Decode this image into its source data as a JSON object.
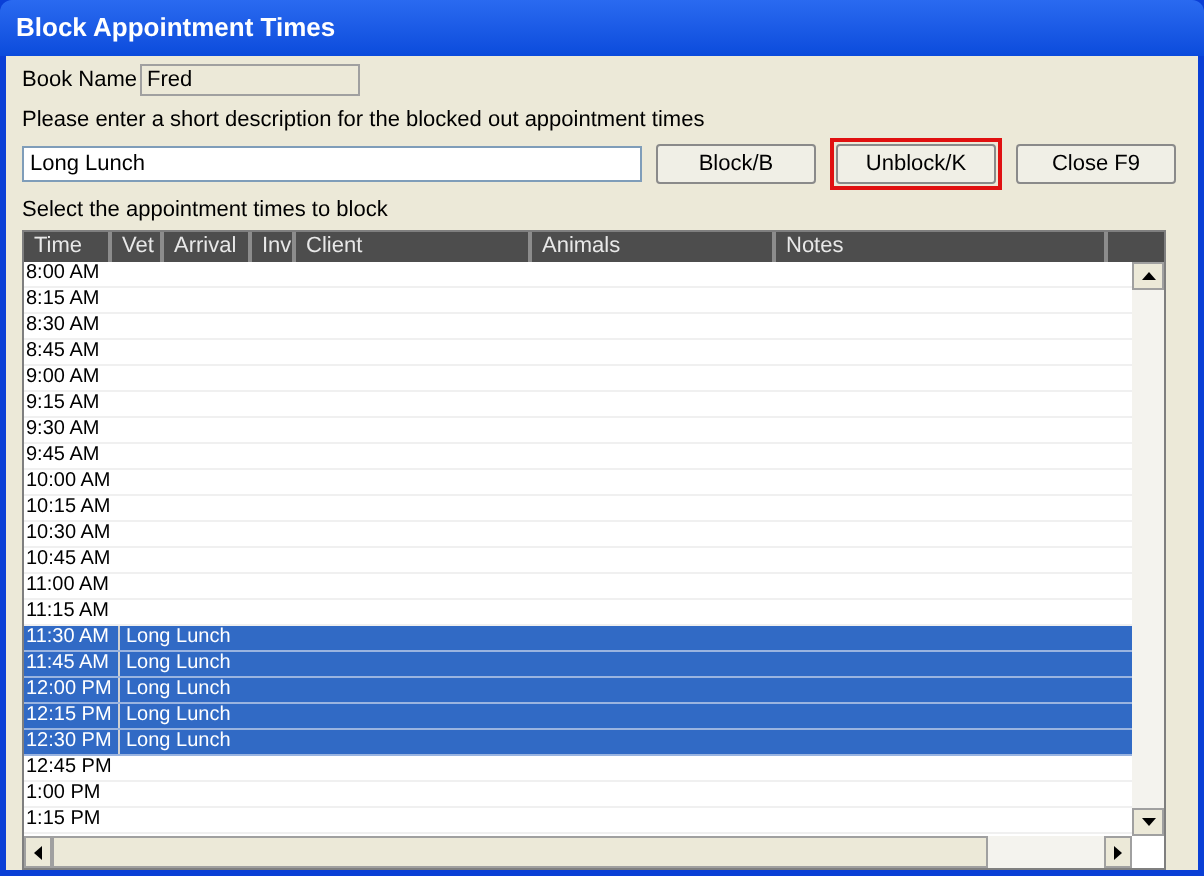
{
  "window": {
    "title": "Block Appointment Times"
  },
  "book_name": {
    "label": "Book Name",
    "value": "Fred"
  },
  "description": {
    "label": "Please enter a short description for the blocked out appointment times",
    "value": "Long Lunch"
  },
  "buttons": [
    {
      "label": "Block/B",
      "highlighted": false
    },
    {
      "label": "Unblock/K",
      "highlighted": true
    },
    {
      "label": "Close F9",
      "highlighted": false
    }
  ],
  "table_label": "Select the appointment times to block",
  "table": {
    "columns": [
      "Time",
      "Vet",
      "Arrival",
      "Inv",
      "Client",
      "Animals",
      "Notes"
    ],
    "rows": [
      {
        "time": "8:00 AM",
        "note": "",
        "selected": false
      },
      {
        "time": "8:15 AM",
        "note": "",
        "selected": false
      },
      {
        "time": "8:30 AM",
        "note": "",
        "selected": false
      },
      {
        "time": "8:45 AM",
        "note": "",
        "selected": false
      },
      {
        "time": "9:00 AM",
        "note": "",
        "selected": false
      },
      {
        "time": "9:15 AM",
        "note": "",
        "selected": false
      },
      {
        "time": "9:30 AM",
        "note": "",
        "selected": false
      },
      {
        "time": "9:45 AM",
        "note": "",
        "selected": false
      },
      {
        "time": "10:00 AM",
        "note": "",
        "selected": false
      },
      {
        "time": "10:15 AM",
        "note": "",
        "selected": false
      },
      {
        "time": "10:30 AM",
        "note": "",
        "selected": false
      },
      {
        "time": "10:45 AM",
        "note": "",
        "selected": false
      },
      {
        "time": "11:00 AM",
        "note": "",
        "selected": false
      },
      {
        "time": "11:15 AM",
        "note": "",
        "selected": false
      },
      {
        "time": "11:30 AM",
        "note": "Long Lunch",
        "selected": true
      },
      {
        "time": "11:45 AM",
        "note": "Long Lunch",
        "selected": true
      },
      {
        "time": "12:00 PM",
        "note": "Long Lunch",
        "selected": true
      },
      {
        "time": "12:15 PM",
        "note": "Long Lunch",
        "selected": true
      },
      {
        "time": "12:30 PM",
        "note": "Long Lunch",
        "selected": true
      },
      {
        "time": "12:45 PM",
        "note": "",
        "selected": false
      },
      {
        "time": "1:00 PM",
        "note": "",
        "selected": false
      },
      {
        "time": "1:15 PM",
        "note": "",
        "selected": false
      }
    ]
  }
}
